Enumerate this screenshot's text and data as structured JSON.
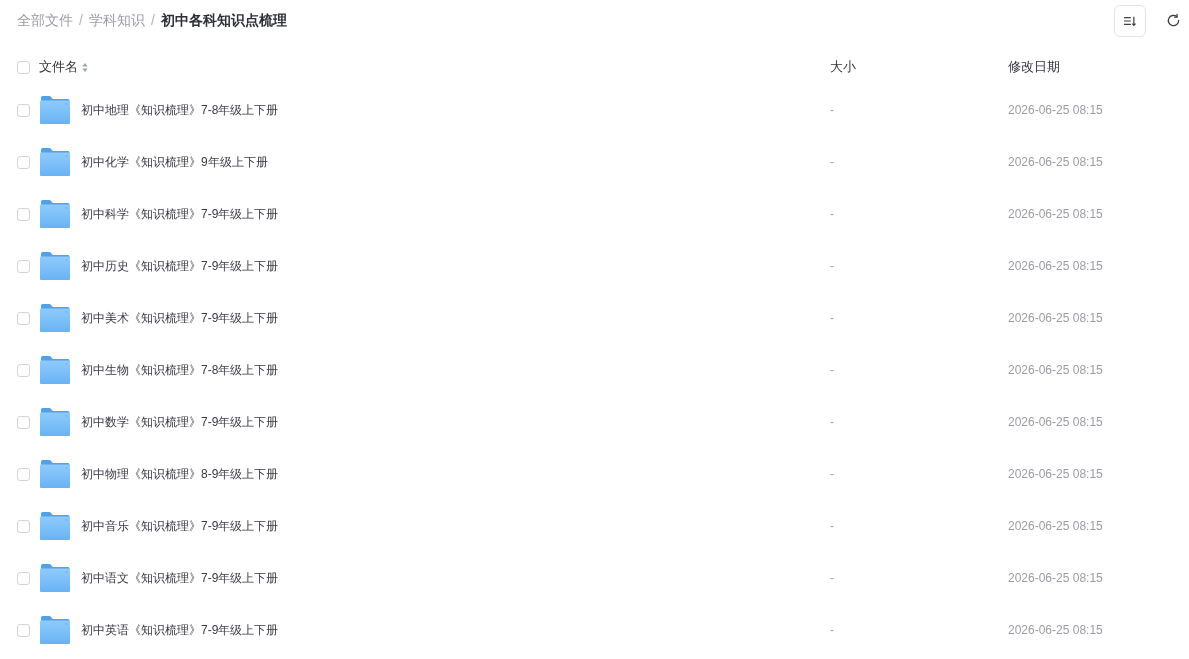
{
  "breadcrumb": [
    {
      "kind": "link",
      "label": "全部文件",
      "current": false
    },
    {
      "kind": "separator",
      "label": "/"
    },
    {
      "kind": "link",
      "label": "学科知识",
      "current": false
    },
    {
      "kind": "separator",
      "label": "/"
    },
    {
      "kind": "link",
      "label": "初中各科知识点梳理",
      "current": true
    }
  ],
  "table": {
    "select_all": {
      "checked": false
    },
    "columns": [
      {
        "label": "文件名",
        "sortable": true
      },
      {
        "label": "大小",
        "sortable": false
      },
      {
        "label": "修改日期",
        "sortable": false
      }
    ],
    "rows": [
      {
        "name": "初中地理《知识梳理》7-8年级上下册",
        "size": "-",
        "modified": "2026-06-25 08:15",
        "checked": false
      },
      {
        "name": "初中化学《知识梳理》9年级上下册",
        "size": "-",
        "modified": "2026-06-25 08:15",
        "checked": false
      },
      {
        "name": "初中科学《知识梳理》7-9年级上下册",
        "size": "-",
        "modified": "2026-06-25 08:15",
        "checked": false
      },
      {
        "name": "初中历史《知识梳理》7-9年级上下册",
        "size": "-",
        "modified": "2026-06-25 08:15",
        "checked": false
      },
      {
        "name": "初中美术《知识梳理》7-9年级上下册",
        "size": "-",
        "modified": "2026-06-25 08:15",
        "checked": false
      },
      {
        "name": "初中生物《知识梳理》7-8年级上下册",
        "size": "-",
        "modified": "2026-06-25 08:15",
        "checked": false
      },
      {
        "name": "初中数学《知识梳理》7-9年级上下册",
        "size": "-",
        "modified": "2026-06-25 08:15",
        "checked": false
      },
      {
        "name": "初中物理《知识梳理》8-9年级上下册",
        "size": "-",
        "modified": "2026-06-25 08:15",
        "checked": false
      },
      {
        "name": "初中音乐《知识梳理》7-9年级上下册",
        "size": "-",
        "modified": "2026-06-25 08:15",
        "checked": false
      },
      {
        "name": "初中语文《知识梳理》7-9年级上下册",
        "size": "-",
        "modified": "2026-06-25 08:15",
        "checked": false
      },
      {
        "name": "初中英语《知识梳理》7-9年级上下册",
        "size": "-",
        "modified": "2026-06-25 08:15",
        "checked": false
      }
    ]
  }
}
